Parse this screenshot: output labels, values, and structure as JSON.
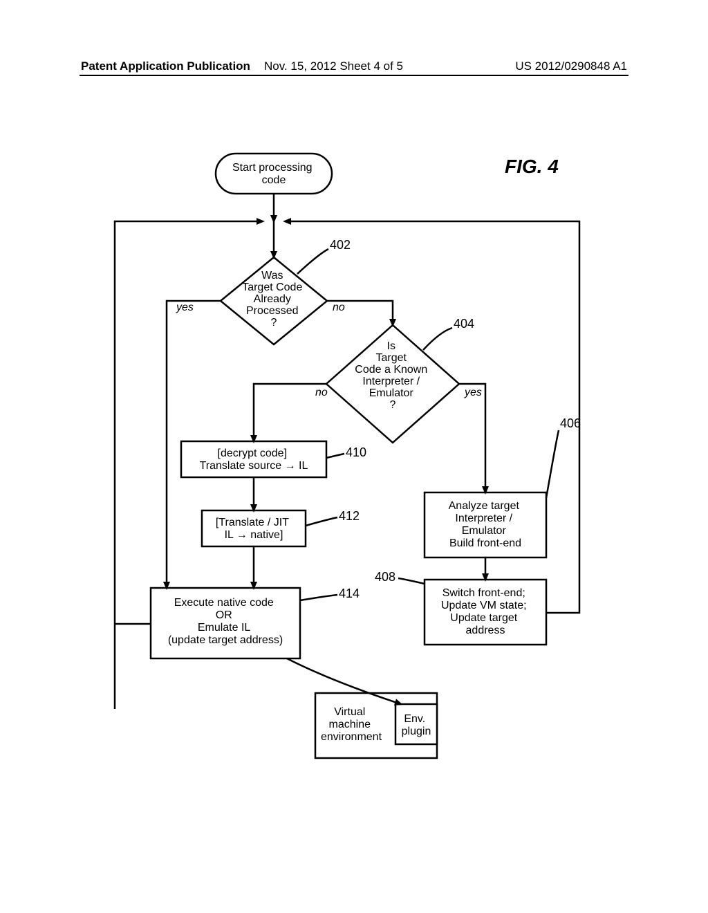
{
  "header": {
    "left": "Patent Application Publication",
    "mid": "Nov. 15, 2012  Sheet 4 of 5",
    "right": "US 2012/0290848 A1"
  },
  "figure": {
    "title": "FIG. 4",
    "nodes": {
      "start": {
        "l1": "Start processing",
        "l2": "code"
      },
      "d402": {
        "l1": "Was",
        "l2": "Target Code",
        "l3": "Already",
        "l4": "Processed",
        "l5": "?"
      },
      "d404": {
        "l1": "Is",
        "l2": "Target",
        "l3": "Code a Known",
        "l4": "Interpreter /",
        "l5": "Emulator",
        "l6": "?"
      },
      "b406": {
        "l1": "Analyze target",
        "l2": "Interpreter /",
        "l3": "Emulator",
        "l4": "Build front-end"
      },
      "b408": {
        "l1": "Switch front-end;",
        "l2": "Update VM state;",
        "l3": "Update target",
        "l4": "address"
      },
      "b410": {
        "l1": "[decrypt code]",
        "l2": "Translate source → IL"
      },
      "b412": {
        "l1": "[Translate / JIT",
        "l2": "IL → native]"
      },
      "b414": {
        "l1": "Execute native code",
        "l2": "OR",
        "l3": "Emulate IL",
        "l4": "(update target address)"
      },
      "vme": {
        "l1": "Virtual",
        "l2": "machine",
        "l3": "environment"
      },
      "envp": {
        "l1": "Env.",
        "l2": "plugin"
      }
    },
    "edges": {
      "yes": "yes",
      "no": "no"
    },
    "refs": {
      "r402": "402",
      "r404": "404",
      "r406": "406",
      "r408": "408",
      "r410": "410",
      "r412": "412",
      "r414": "414"
    }
  }
}
